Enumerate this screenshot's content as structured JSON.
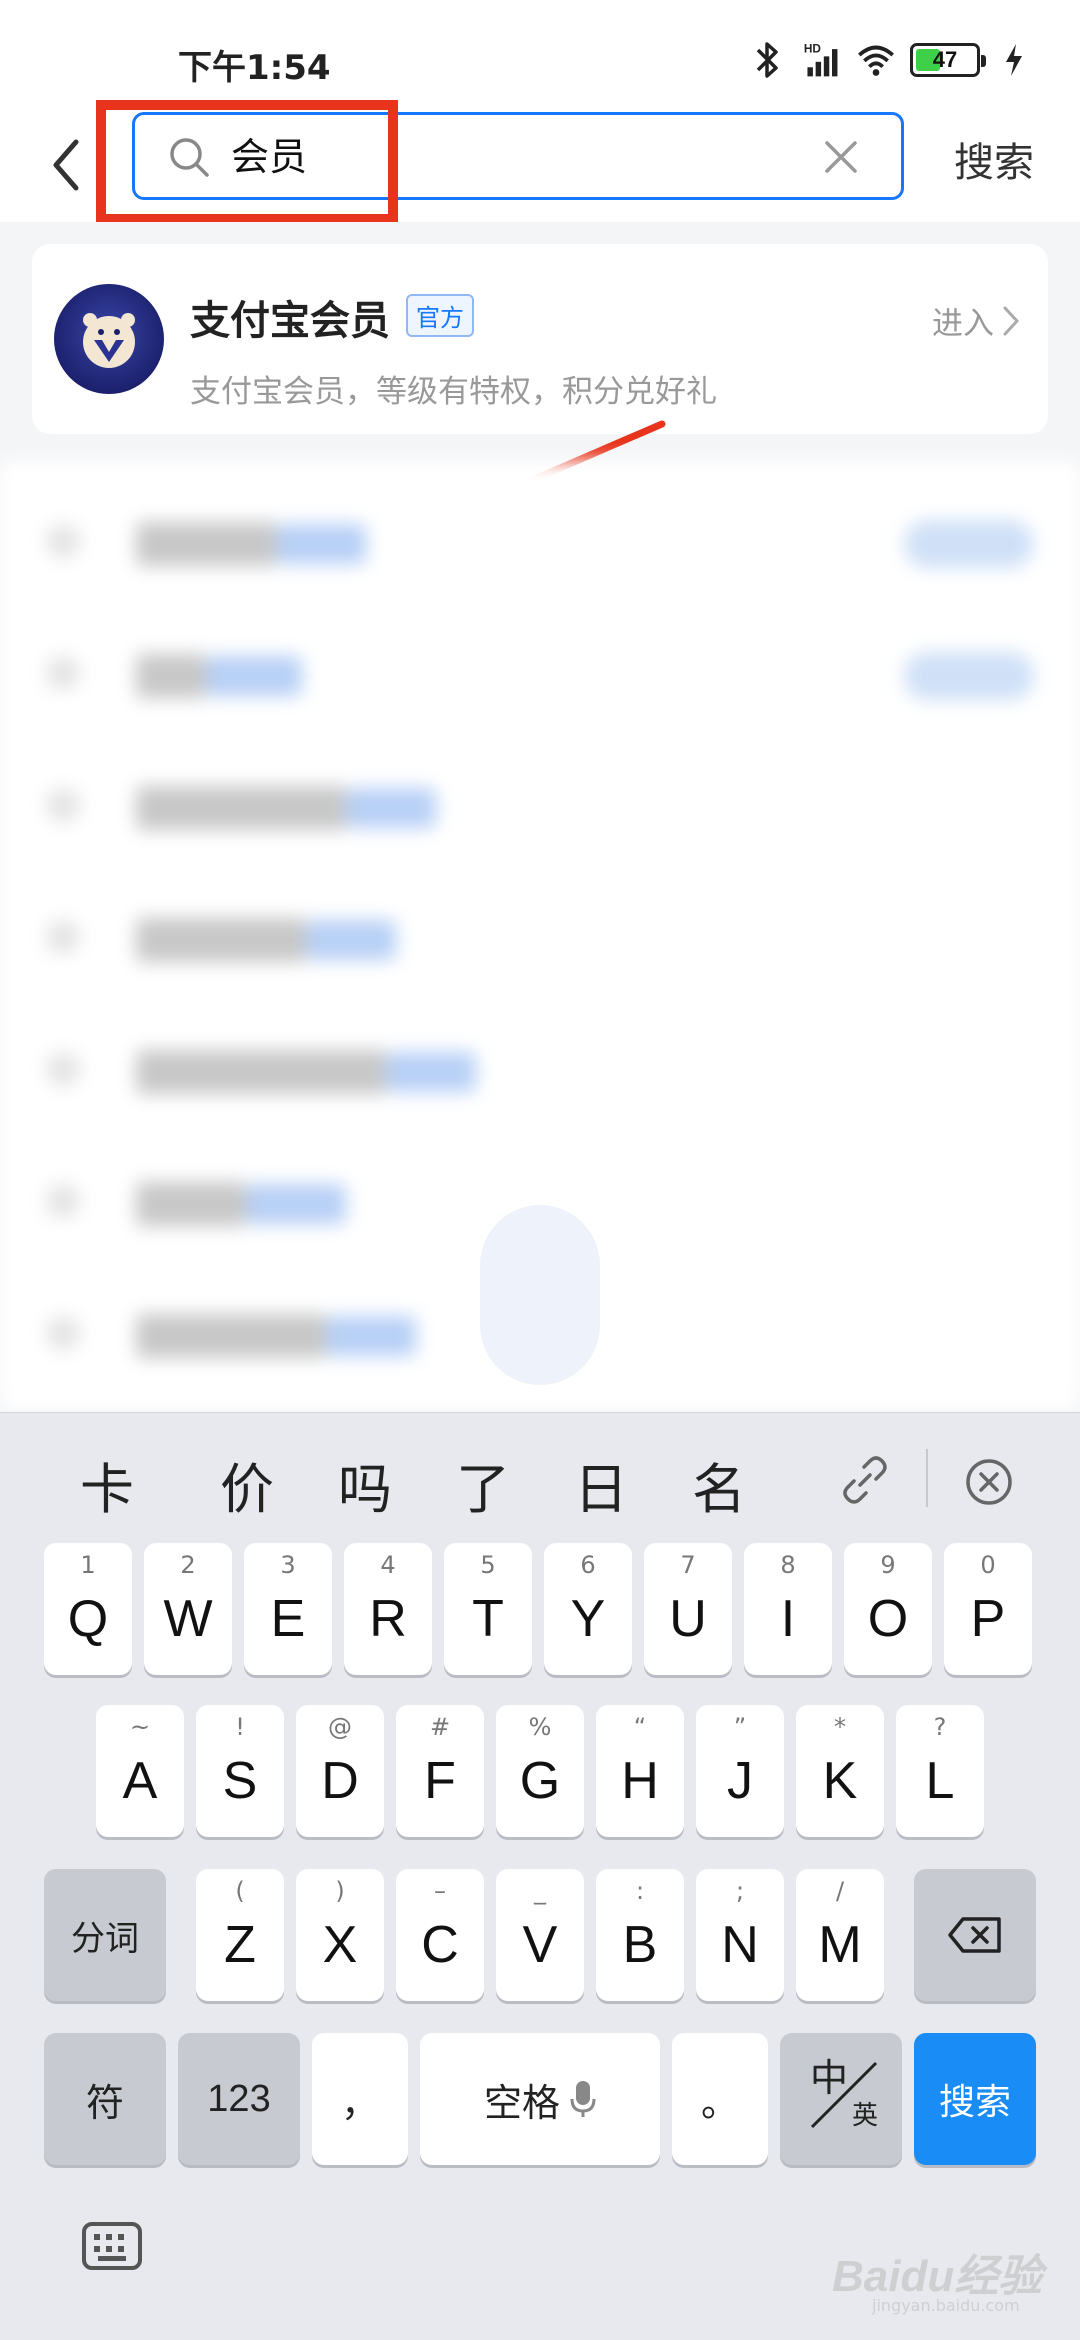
{
  "status_bar": {
    "time": "下午1:54",
    "battery": "47",
    "battery_color": "#3fd04a",
    "network": "HD"
  },
  "header": {
    "search_value": "会员",
    "search_button": "搜索"
  },
  "result": {
    "name": "支付宝会员",
    "badge": "官方",
    "description": "支付宝会员，等级有特权，积分兑好礼",
    "enter": "进入"
  },
  "colors": {
    "accent": "#1677ff",
    "annotation": "#e8341c"
  },
  "keyboard": {
    "candidates": [
      "卡",
      "价",
      "吗",
      "了",
      "日",
      "名"
    ],
    "row1": [
      {
        "main": "Q",
        "sub": "1"
      },
      {
        "main": "W",
        "sub": "2"
      },
      {
        "main": "E",
        "sub": "3"
      },
      {
        "main": "R",
        "sub": "4"
      },
      {
        "main": "T",
        "sub": "5"
      },
      {
        "main": "Y",
        "sub": "6"
      },
      {
        "main": "U",
        "sub": "7"
      },
      {
        "main": "I",
        "sub": "8"
      },
      {
        "main": "O",
        "sub": "9"
      },
      {
        "main": "P",
        "sub": "0"
      }
    ],
    "row2": [
      {
        "main": "A",
        "sub": "~"
      },
      {
        "main": "S",
        "sub": "!"
      },
      {
        "main": "D",
        "sub": "@"
      },
      {
        "main": "F",
        "sub": "#"
      },
      {
        "main": "G",
        "sub": "%"
      },
      {
        "main": "H",
        "sub": "“"
      },
      {
        "main": "J",
        "sub": "”"
      },
      {
        "main": "K",
        "sub": "*"
      },
      {
        "main": "L",
        "sub": "?"
      }
    ],
    "row3": [
      {
        "main": "Z",
        "sub": "("
      },
      {
        "main": "X",
        "sub": ")"
      },
      {
        "main": "C",
        "sub": "–"
      },
      {
        "main": "V",
        "sub": "_"
      },
      {
        "main": "B",
        "sub": ":"
      },
      {
        "main": "N",
        "sub": ";"
      },
      {
        "main": "M",
        "sub": "/"
      }
    ],
    "segment_key": "分词",
    "symbol_key": "符",
    "number_key": "123",
    "comma_key": "，",
    "space_key": "空格",
    "period_key": "。",
    "lang_main": "中",
    "lang_sub": "英",
    "search_key": "搜索"
  },
  "watermark": {
    "brand": "Baidu经验",
    "url": "jingyan.baidu.com"
  }
}
